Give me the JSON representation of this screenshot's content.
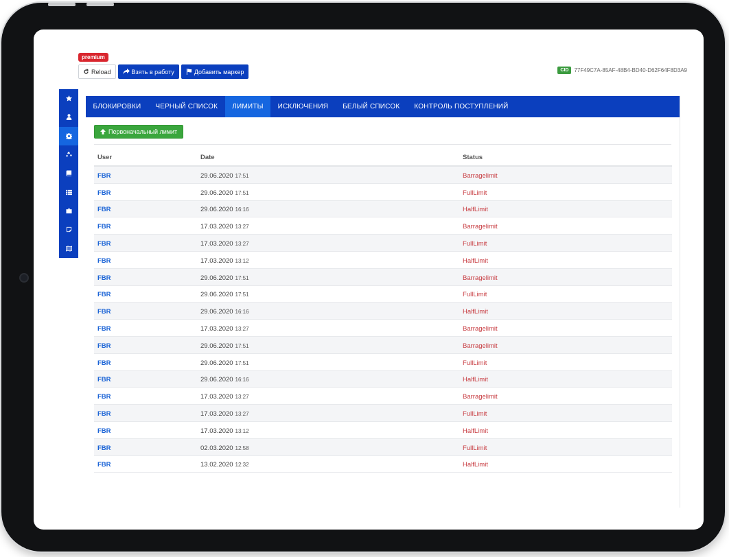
{
  "badge": "premium",
  "toolbar": {
    "reload": "Reload",
    "take": "Взять в работу",
    "marker": "Добавить маркер"
  },
  "cid": {
    "label": "CID",
    "value": "77F49C7A-85AF-48B4-BD40-D62F64F8D3A9"
  },
  "sidenav": [
    {
      "icon": "star-icon"
    },
    {
      "icon": "user-icon"
    },
    {
      "icon": "gear-icon",
      "active": true
    },
    {
      "icon": "recycle-icon"
    },
    {
      "icon": "book-icon"
    },
    {
      "icon": "list-icon"
    },
    {
      "icon": "briefcase-icon"
    },
    {
      "icon": "note-icon"
    },
    {
      "icon": "map-icon"
    }
  ],
  "tabs": [
    {
      "label": "БЛОКИРОВКИ"
    },
    {
      "label": "ЧЕРНЫЙ СПИСОК"
    },
    {
      "label": "ЛИМИТЫ",
      "active": true
    },
    {
      "label": "ИСКЛЮЧЕНИЯ"
    },
    {
      "label": "БЕЛЫЙ СПИСОК"
    },
    {
      "label": "КОНТРОЛЬ ПОСТУПЛЕНИЙ"
    }
  ],
  "action_button": "Первоначальный лимит",
  "table": {
    "headers": [
      "User",
      "Date",
      "Status"
    ],
    "rows": [
      {
        "user": "FBR",
        "date": "29.06.2020",
        "time": "17:51",
        "status": "Barragelimit"
      },
      {
        "user": "FBR",
        "date": "29.06.2020",
        "time": "17:51",
        "status": "FullLimit"
      },
      {
        "user": "FBR",
        "date": "29.06.2020",
        "time": "16:16",
        "status": "HalfLimit"
      },
      {
        "user": "FBR",
        "date": "17.03.2020",
        "time": "13:27",
        "status": "Barragelimit"
      },
      {
        "user": "FBR",
        "date": "17.03.2020",
        "time": "13:27",
        "status": "FullLimit"
      },
      {
        "user": "FBR",
        "date": "17.03.2020",
        "time": "13:12",
        "status": "HalfLimit"
      },
      {
        "user": "FBR",
        "date": "29.06.2020",
        "time": "17:51",
        "status": "Barragelimit"
      },
      {
        "user": "FBR",
        "date": "29.06.2020",
        "time": "17:51",
        "status": "FullLimit"
      },
      {
        "user": "FBR",
        "date": "29.06.2020",
        "time": "16:16",
        "status": "HalfLimit"
      },
      {
        "user": "FBR",
        "date": "17.03.2020",
        "time": "13:27",
        "status": "Barragelimit"
      },
      {
        "user": "FBR",
        "date": "29.06.2020",
        "time": "17:51",
        "status": "Barragelimit"
      },
      {
        "user": "FBR",
        "date": "29.06.2020",
        "time": "17:51",
        "status": "FullLimit"
      },
      {
        "user": "FBR",
        "date": "29.06.2020",
        "time": "16:16",
        "status": "HalfLimit"
      },
      {
        "user": "FBR",
        "date": "17.03.2020",
        "time": "13:27",
        "status": "Barragelimit"
      },
      {
        "user": "FBR",
        "date": "17.03.2020",
        "time": "13:27",
        "status": "FullLimit"
      },
      {
        "user": "FBR",
        "date": "17.03.2020",
        "time": "13:12",
        "status": "HalfLimit"
      },
      {
        "user": "FBR",
        "date": "02.03.2020",
        "time": "12:58",
        "status": "FullLimit"
      },
      {
        "user": "FBR",
        "date": "13.02.2020",
        "time": "12:32",
        "status": "HalfLimit"
      }
    ]
  }
}
